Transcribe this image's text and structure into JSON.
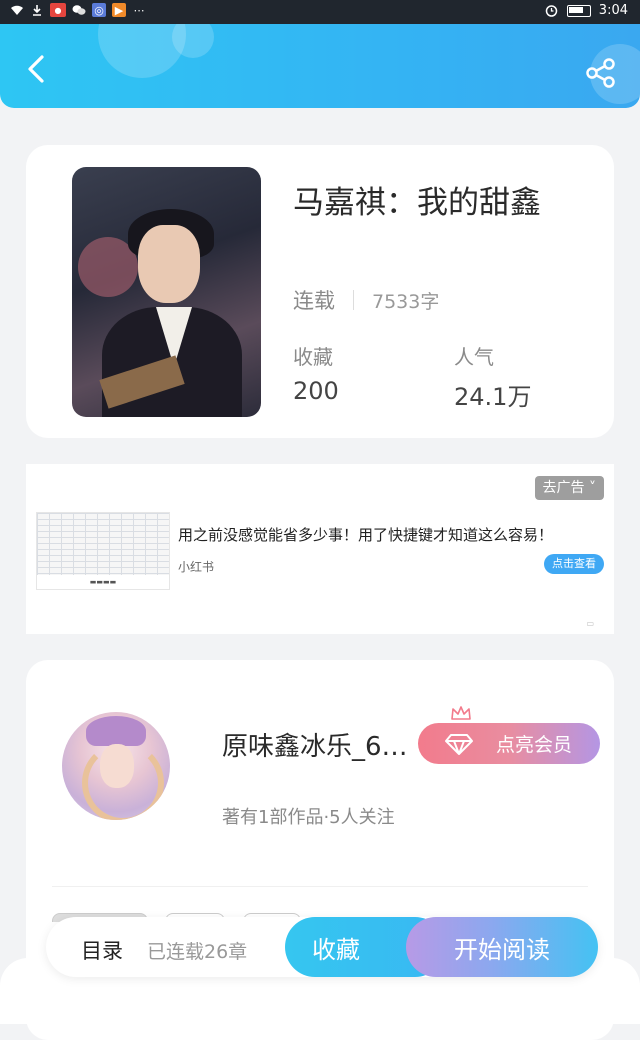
{
  "status_bar": {
    "time": "3:04"
  },
  "book": {
    "title": "马嘉祺：我的甜鑫",
    "status": "连载",
    "word_count": "7533字",
    "stats": [
      {
        "label": "收藏",
        "value": "200"
      },
      {
        "label": "人气",
        "value": "24.1万"
      }
    ]
  },
  "ad": {
    "remove_label": "去广告",
    "text": "用之前没感觉能省多少事！用了快捷键才知道这么容易！",
    "source": "小红书",
    "cta": "点击查看"
  },
  "author": {
    "name": "原味鑫冰乐_6…",
    "meta": "著有1部作品·5人关注",
    "vip_button": "点亮会员"
  },
  "bottom_bar": {
    "toc_label": "目录",
    "serial_label": "已连载26章",
    "collect_label": "收藏",
    "read_label": "开始阅读"
  },
  "colors": {
    "accent_blue": "#35b1f3",
    "vip_gradient_start": "#f27b8c",
    "vip_gradient_end": "#b496e4"
  }
}
